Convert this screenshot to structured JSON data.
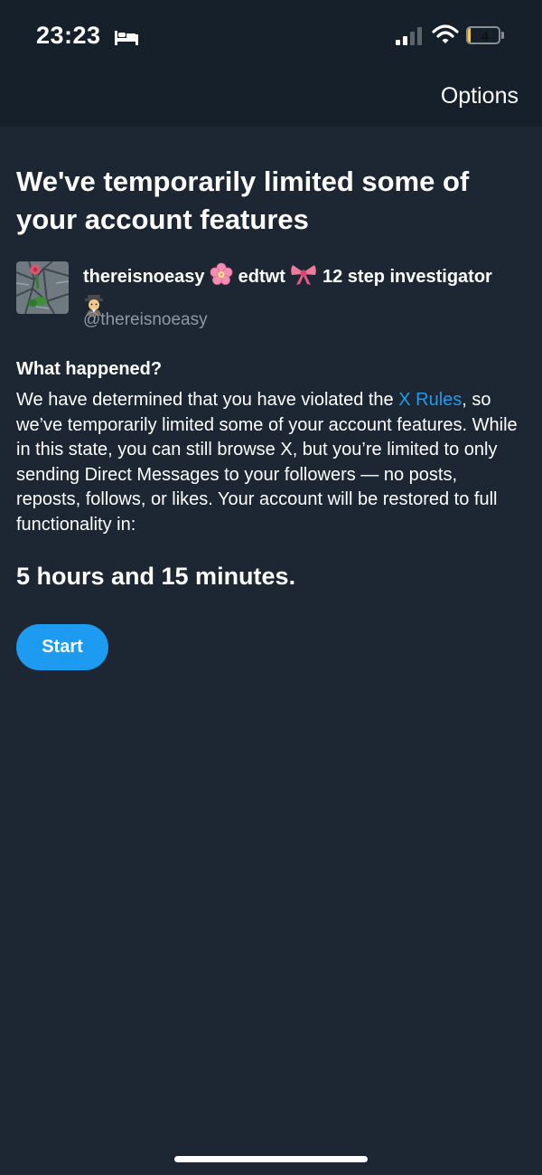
{
  "status_bar": {
    "time": "23:23",
    "battery_level": "4",
    "battery_fraction": 0.1,
    "icons": [
      "bed-icon",
      "cellular-signal-icon",
      "wifi-icon",
      "battery-icon"
    ]
  },
  "header": {
    "options_label": "Options"
  },
  "main": {
    "title": "We've temporarily limited some of your account features",
    "account": {
      "name_parts": [
        "thereisnoeasy",
        "edtwt",
        "12 step investigator"
      ],
      "emojis": [
        "🌸",
        "🎀",
        "🕵"
      ],
      "handle": "@thereisnoeasy"
    },
    "what_happened_heading": "What happened?",
    "body_before_link": "We have determined that you have violated the ",
    "body_link": "X Rules",
    "body_after_link": ", so we’ve temporarily limited some of your account features. While in this state, you can still browse X, but you’re limited to only sending Direct Messages to your followers — no posts, reposts, follows, or likes. Your account will be restored to full functionality in:",
    "countdown": "5 hours and 15 minutes.",
    "start_label": "Start"
  },
  "colors": {
    "background": "#1c2733",
    "header_background": "#15202b",
    "accent": "#1d9bf0",
    "secondary_text": "#8b98a5"
  }
}
